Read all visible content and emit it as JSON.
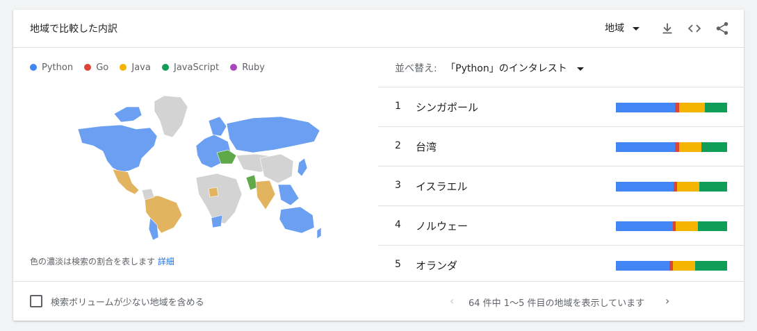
{
  "header": {
    "title": "地域で比較した内訳",
    "region_select": "地域",
    "icons": [
      "download-icon",
      "embed-code-icon",
      "share-icon"
    ]
  },
  "legend": [
    {
      "label": "Python",
      "color": "#4285f4"
    },
    {
      "label": "Go",
      "color": "#db4437"
    },
    {
      "label": "Java",
      "color": "#f4b400"
    },
    {
      "label": "JavaScript",
      "color": "#0f9d58"
    },
    {
      "label": "Ruby",
      "color": "#ab47bc"
    }
  ],
  "map_colors": {
    "python": "#6b9ff2",
    "java": "#e3b45f",
    "javascript": "#5fa94a",
    "nodata": "#d3d3d3"
  },
  "note": {
    "text": "色の濃淡は検索の割合を表します",
    "link": "詳細"
  },
  "sort": {
    "label": "並べ替え:",
    "value": "「Python」のインタレスト"
  },
  "rankings": [
    {
      "rank": "1",
      "name": "シンガポール",
      "shares": [
        0.53,
        0.04,
        0.23,
        0.2
      ]
    },
    {
      "rank": "2",
      "name": "台湾",
      "shares": [
        0.53,
        0.04,
        0.2,
        0.23
      ]
    },
    {
      "rank": "3",
      "name": "イスラエル",
      "shares": [
        0.52,
        0.03,
        0.2,
        0.25
      ]
    },
    {
      "rank": "4",
      "name": "ノルウェー",
      "shares": [
        0.51,
        0.03,
        0.2,
        0.26
      ]
    },
    {
      "rank": "5",
      "name": "オランダ",
      "shares": [
        0.48,
        0.03,
        0.2,
        0.29
      ]
    }
  ],
  "footer": {
    "checkbox_label": "検索ボリュームが少ない地域を含める",
    "checkbox_checked": false,
    "pager_text": "64 件中 1～5 件目の地域を表示しています"
  }
}
